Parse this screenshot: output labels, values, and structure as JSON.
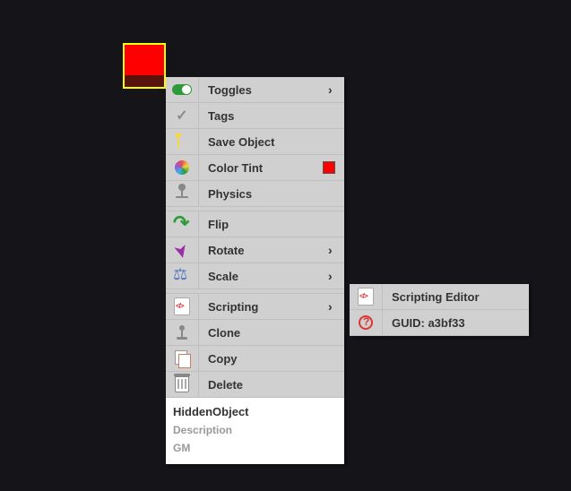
{
  "object": {
    "name": "HiddenObject",
    "description_placeholder": "Description",
    "gm_label": "GM",
    "color_swatch": "#ff0000"
  },
  "menu": {
    "toggles": "Toggles",
    "tags": "Tags",
    "save": "Save Object",
    "tint": "Color Tint",
    "physics": "Physics",
    "flip": "Flip",
    "rotate": "Rotate",
    "scale": "Scale",
    "scripting": "Scripting",
    "clone": "Clone",
    "copy": "Copy",
    "delete": "Delete"
  },
  "submenu": {
    "editor": "Scripting Editor",
    "guid_prefix": "GUID: ",
    "guid_value": "a3bf33"
  }
}
